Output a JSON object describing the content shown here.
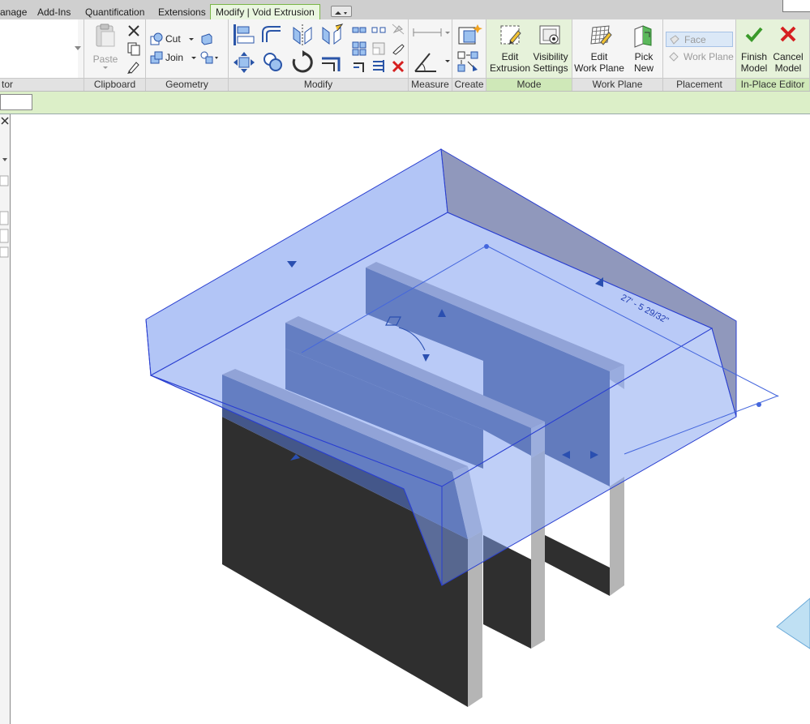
{
  "tabs": [
    {
      "label": "anage",
      "active": false
    },
    {
      "label": "Add-Ins",
      "active": false
    },
    {
      "label": "Quantification",
      "active": false
    },
    {
      "label": "Extensions",
      "active": false
    },
    {
      "label": "Modify | Void Extrusion",
      "active": true
    }
  ],
  "ribbon": {
    "editor_panel_title": "tor",
    "clipboard": {
      "title": "Clipboard",
      "paste_label": "Paste"
    },
    "geometry": {
      "title": "Geometry",
      "cut_label": "Cut",
      "join_label": "Join"
    },
    "modify": {
      "title": "Modify"
    },
    "measure": {
      "title": "Measure"
    },
    "create": {
      "title": "Create"
    },
    "mode": {
      "title": "Mode",
      "edit_extrusion": [
        "Edit",
        "Extrusion"
      ],
      "visibility_settings": [
        "Visibility",
        "Settings"
      ]
    },
    "work_plane": {
      "title": "Work Plane",
      "edit_work_plane": [
        "Edit",
        "Work Plane"
      ],
      "pick_new": [
        "Pick",
        "New"
      ]
    },
    "placement": {
      "title": "Placement",
      "face": "Face",
      "work_plane_label": "Work Plane"
    },
    "in_place_editor": {
      "title": "In-Place Editor",
      "finish_model": [
        "Finish",
        "Model"
      ],
      "cancel_model": [
        "Cancel",
        "Model"
      ]
    }
  },
  "viewport": {
    "dimension_label": "27' - 5 29/32\""
  },
  "colors": {
    "active_tab_border": "#7ab648",
    "void_fill": "#7f9ff0",
    "void_edge": "#2a3fd0",
    "solid_dark": "#2f2f2f",
    "panel_green": "#e6f2da",
    "finish_check": "#3a9a2a",
    "cancel_x": "#d62020"
  },
  "icons": [
    "paste-icon",
    "cut-scissors-icon",
    "copy-icon",
    "match-properties-icon",
    "cut-geometry-icon",
    "join-geometry-icon",
    "align-icon",
    "offset-icon",
    "mirror-axis-icon",
    "mirror-draw-icon",
    "move-icon",
    "copy-element-icon",
    "rotate-icon",
    "trim-icon",
    "split-icon",
    "pin-icon",
    "delete-icon",
    "measure-icon",
    "angle-icon",
    "create-similar-icon",
    "edit-extrusion-icon",
    "visibility-settings-icon",
    "edit-work-plane-icon",
    "pick-new-icon",
    "finish-check-icon",
    "cancel-x-icon"
  ]
}
